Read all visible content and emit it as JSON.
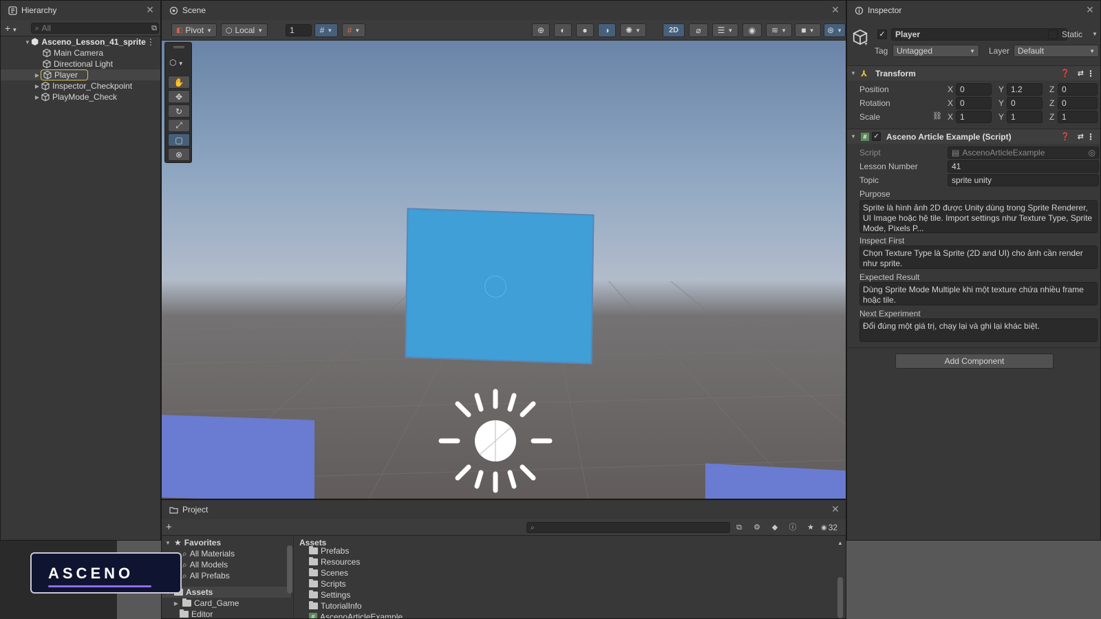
{
  "colors": {
    "panel_bg": "#383838",
    "tab_bg": "#282828",
    "selection": "#2c5d87",
    "player_highlight": "#d4c44a",
    "cube_blue": "#3f9fd6",
    "side_blue": "#6a7bd2",
    "logo_purple": "#8f6cf0"
  },
  "hierarchy": {
    "tab_label": "Hierarchy",
    "search_placeholder": "All",
    "scene_name": "Asceno_Lesson_41_sprite",
    "items": [
      {
        "label": "Main Camera"
      },
      {
        "label": "Directional Light"
      },
      {
        "label": "Player"
      },
      {
        "label": "Inspector_Checkpoint"
      },
      {
        "label": "PlayMode_Check"
      }
    ]
  },
  "scene": {
    "tab_label": "Scene",
    "toolbar": {
      "pivot": "Pivot",
      "local": "Local",
      "grid_snap_value": "1",
      "mode_2d": "2D"
    }
  },
  "inspector": {
    "tab_label": "Inspector",
    "object_name": "Player",
    "static_label": "Static",
    "tag_label": "Tag",
    "tag_value": "Untagged",
    "layer_label": "Layer",
    "layer_value": "Default",
    "transform": {
      "title": "Transform",
      "position_label": "Position",
      "rotation_label": "Rotation",
      "scale_label": "Scale",
      "position": {
        "x": "0",
        "y": "1.2",
        "z": "0"
      },
      "rotation": {
        "x": "0",
        "y": "0",
        "z": "0"
      },
      "scale": {
        "x": "1",
        "y": "1",
        "z": "1"
      }
    },
    "axes": {
      "x": "X",
      "y": "Y",
      "z": "Z"
    },
    "script_component": {
      "title": "Asceno Article Example (Script)",
      "script_label": "Script",
      "script_value": "AscenoArticleExample",
      "lesson_label": "Lesson Number",
      "lesson_value": "41",
      "topic_label": "Topic",
      "topic_value": "sprite unity",
      "purpose_label": "Purpose",
      "purpose_value": "Sprite là hình ảnh 2D được Unity dùng trong Sprite Renderer, UI Image hoặc hệ tile. Import settings như Texture Type, Sprite Mode, Pixels P...",
      "inspect_label": "Inspect First",
      "inspect_value": "Chọn Texture Type là Sprite (2D and UI) cho ảnh cần render như sprite.",
      "expected_label": "Expected Result",
      "expected_value": "Dùng Sprite Mode Multiple khi một texture chứa nhiều frame hoặc tile.",
      "next_label": "Next Experiment",
      "next_value": "Đổi đúng một giá trị, chạy lại và ghi lại khác biệt."
    },
    "add_component": "Add Component"
  },
  "project": {
    "tab_label": "Project",
    "visibility_count": "32",
    "favorites_label": "Favorites",
    "favorites": [
      {
        "label": "All Materials"
      },
      {
        "label": "All Models"
      },
      {
        "label": "All Prefabs"
      }
    ],
    "assets_label": "Assets",
    "assets_tree": [
      {
        "label": "Card_Game"
      },
      {
        "label": "Editor"
      }
    ],
    "breadcrumb": "Assets",
    "asset_items": [
      {
        "label": "Prefabs"
      },
      {
        "label": "Resources"
      },
      {
        "label": "Scenes"
      },
      {
        "label": "Scripts"
      },
      {
        "label": "Settings"
      },
      {
        "label": "TutorialInfo"
      },
      {
        "label": "AscenoArticleExample"
      }
    ]
  },
  "logo": {
    "text": "ASCENO"
  }
}
